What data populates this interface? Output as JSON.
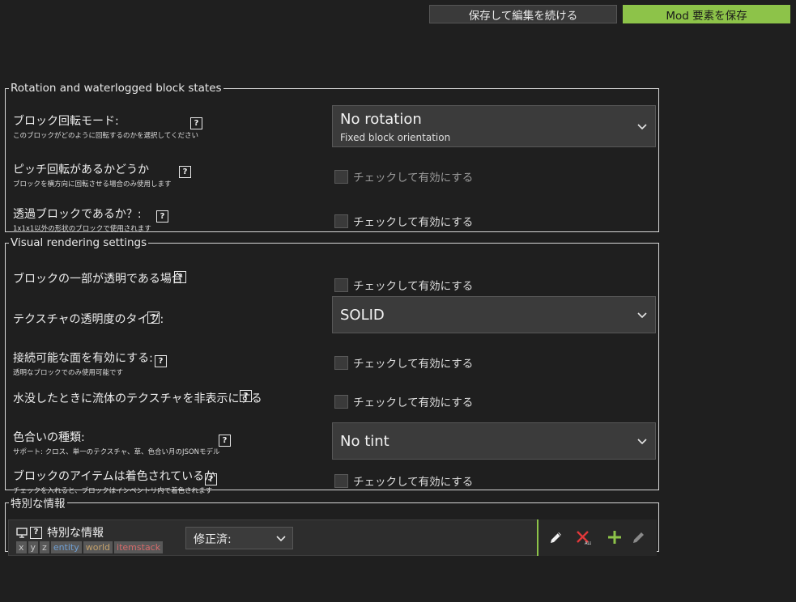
{
  "toolbar": {
    "save_continue_label": "保存して編集を続ける",
    "save_mod_label": "Mod 要素を保存"
  },
  "rotation_section": {
    "title": "Rotation and waterlogged block states",
    "rotation_mode": {
      "label": "ブロック回転モード:",
      "hint": "このブロックがどのように回転するのかを選択してください",
      "value": "No rotation",
      "value_sub": "Fixed block orientation"
    },
    "pitch_rotation": {
      "label": "ピッチ回転があるかどうか",
      "hint": "ブロックを横方向に回転させる場合のみ使用します",
      "checkbox_label": "チェックして有効にする"
    },
    "waterloggable": {
      "label": "透過ブロックであるか？:",
      "hint": "1x1x1以外の形状のブロックで使用されます",
      "checkbox_label": "チェックして有効にする"
    }
  },
  "visual_section": {
    "title": "Visual rendering settings",
    "partial_transparent": {
      "label": "ブロックの一部が透明である場合",
      "checkbox_label": "チェックして有効にする"
    },
    "transparency_type": {
      "label": "テクスチャの透明度のタイプ:",
      "value": "SOLID"
    },
    "connected_sides": {
      "label": "接続可能な面を有効にする:",
      "hint": "透明なブロックでのみ使用可能です",
      "checkbox_label": "チェックして有効にする"
    },
    "hide_fluid": {
      "label": "水没したときに流体のテクスチャを非表示にする",
      "checkbox_label": "チェックして有効にする"
    },
    "tint_type": {
      "label": "色合いの種類:",
      "hint": "サポート: クロス、単一のテクスチャ、草、色合い月のJSONモデル",
      "value": "No tint"
    },
    "item_tinted": {
      "label": "ブロックのアイテムは着色されているか",
      "hint": "チェックを入れると、ブロックはインベントリ内で着色されます",
      "checkbox_label": "チェックして有効にする"
    }
  },
  "special_section": {
    "title": "特別な情報",
    "procedure": {
      "title": "特別な情報",
      "dependencies": [
        "x",
        "y",
        "z",
        "entity",
        "world",
        "itemstack"
      ],
      "mode_value": "修正済:"
    }
  },
  "help_glyph": "?",
  "colors": {
    "background": "#1f1f1f",
    "accent": "#8dc349",
    "panel": "#3b3b3b",
    "remove": "#e0383a"
  },
  "icons": [
    "monitor-icon",
    "help-icon",
    "chevron-down-icon",
    "pencil-icon",
    "remove-all-icon",
    "add-icon"
  ]
}
